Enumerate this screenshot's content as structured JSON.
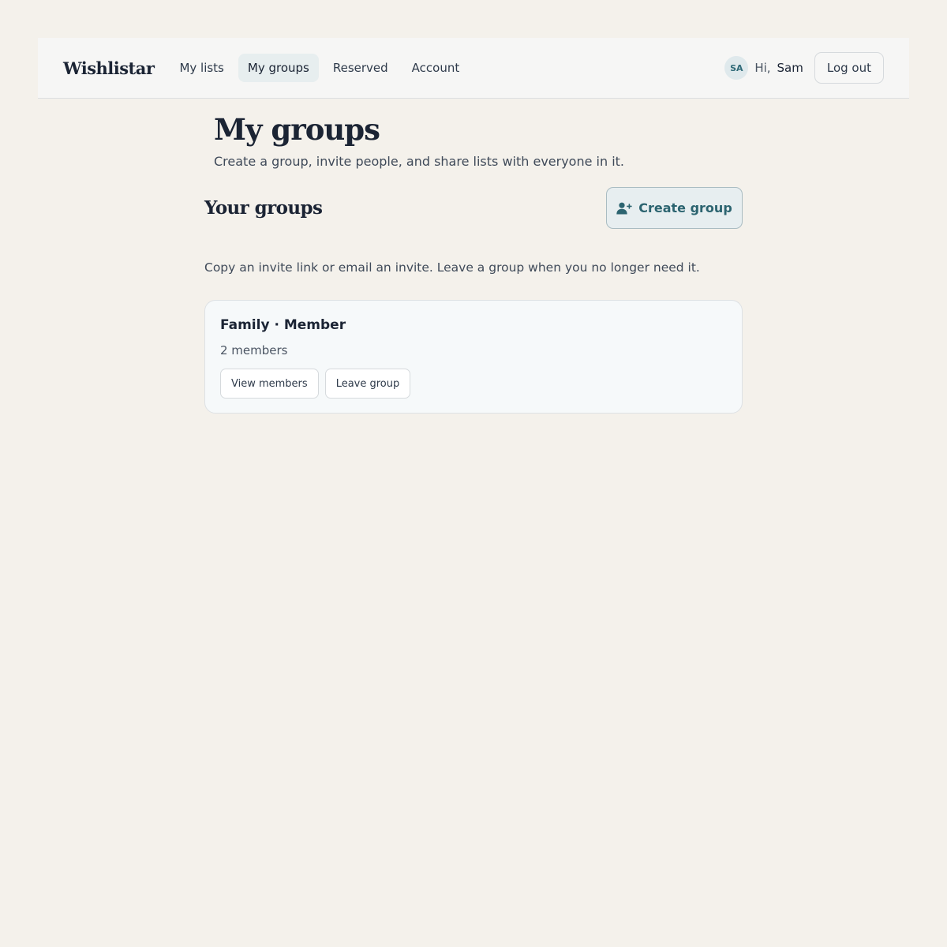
{
  "brand": "Wishlistar",
  "nav": {
    "items": [
      {
        "label": "My lists"
      },
      {
        "label": "My groups"
      },
      {
        "label": "Reserved"
      },
      {
        "label": "Account"
      }
    ],
    "active": "My groups"
  },
  "user": {
    "initials": "SA",
    "greeting": "Hi,",
    "name": "Sam",
    "logout_label": "Log out"
  },
  "page": {
    "title": "My groups",
    "subtitle": "Create a group, invite people, and share lists with everyone in it."
  },
  "section": {
    "title": "Your groups",
    "create_label": "Create group",
    "create_icon": "user-plus-icon",
    "help": "Copy an invite link or email an invite. Leave a group when you no longer need it."
  },
  "groups": [
    {
      "title": "Family · Member",
      "members": "2 members",
      "view_label": "View members",
      "leave_label": "Leave group"
    }
  ],
  "colors": {
    "background": "#f4f1eb",
    "accent": "#2c6470",
    "text": "#1b2434"
  }
}
